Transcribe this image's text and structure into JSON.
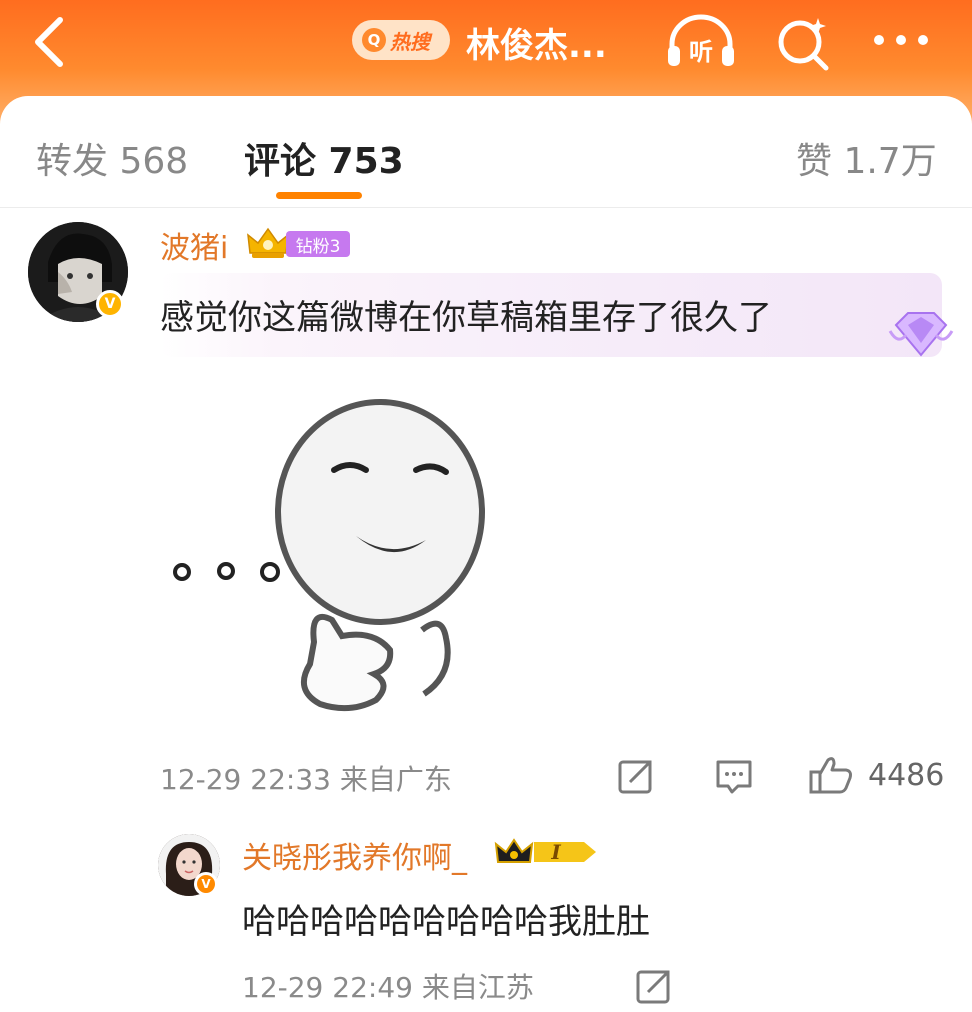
{
  "header": {
    "hot_search_label": "热搜",
    "title": "林俊杰...",
    "listen_label": "听"
  },
  "tabs": [
    {
      "label": "转发 568"
    },
    {
      "label": "评论 753"
    },
    {
      "label": "赞 1.7万"
    }
  ],
  "comments": [
    {
      "username": "波猪i",
      "fan_badge": "钻粉3",
      "text": "感觉你这篇微博在你草稿箱里存了很久了",
      "meta": "12-29 22:33 来自广东",
      "like_count": "4486"
    }
  ],
  "reply": {
    "username": "关晓彤我养你啊_",
    "vip_level": "I",
    "text": "哈哈哈哈哈哈哈哈哈我肚肚",
    "meta": "12-29 22:49 来自江苏"
  },
  "colors": {
    "brand_orange": "#ff8200",
    "username_orange": "#e27829",
    "fan_badge_purple": "#c679ef"
  }
}
